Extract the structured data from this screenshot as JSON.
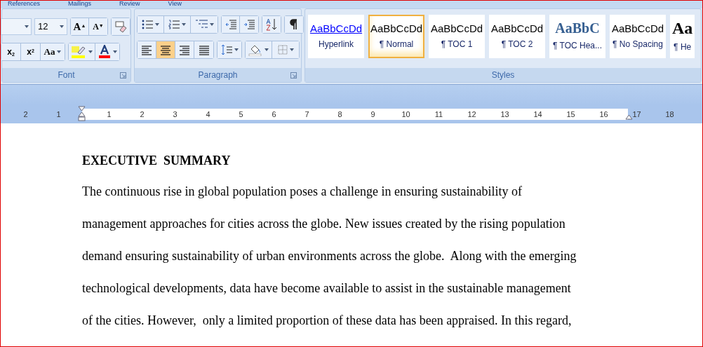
{
  "tabs": [
    "References",
    "Mailings",
    "Review",
    "View"
  ],
  "font_group": {
    "label": "Font",
    "size": "12",
    "grow": "A$^{▲}$",
    "shrink": "A$^{▼}$",
    "subscript": "x$_{2}$",
    "superscript": "x$^{2}$",
    "change_case": "Aa"
  },
  "paragraph_group": {
    "label": "Paragraph",
    "alignment": [
      {
        "kind": "left",
        "selected": false
      },
      {
        "kind": "center",
        "selected": true
      },
      {
        "kind": "right",
        "selected": false
      },
      {
        "kind": "justify",
        "selected": false
      }
    ]
  },
  "styles_group": {
    "label": "Styles",
    "styles": [
      {
        "sample": "AaBbCcDd",
        "name": "Hyperlink",
        "kind": "hyperlink",
        "selected": false
      },
      {
        "sample": "AaBbCcDd",
        "name": "¶ Normal",
        "kind": "plain",
        "selected": true
      },
      {
        "sample": "AaBbCcDd",
        "name": "¶ TOC 1",
        "kind": "plain",
        "selected": false
      },
      {
        "sample": "AaBbCcDd",
        "name": "¶ TOC 2",
        "kind": "plain",
        "selected": false
      },
      {
        "sample": "AaBbC",
        "name": "¶ TOC Hea...",
        "kind": "toc-heading",
        "selected": false
      },
      {
        "sample": "AaBbCcDd",
        "name": "¶ No Spacing",
        "kind": "plain",
        "selected": false
      },
      {
        "sample": "Aa",
        "name": "¶ He",
        "kind": "heading",
        "selected": false
      }
    ]
  },
  "ruler": [
    "2",
    "1",
    "1",
    "2",
    "3",
    "4",
    "5",
    "6",
    "7",
    "8",
    "9",
    "10",
    "11",
    "12",
    "13",
    "14",
    "15",
    "16",
    "17",
    "18"
  ],
  "document": {
    "heading": "EXECUTIVE  SUMMARY",
    "lines": [
      "The continuous rise in global population poses a challenge in ensuring sustainability of",
      "management approaches for cities across the globe. New issues created by the rising population",
      "demand ensuring sustainability of urban environments across the globe.  Along with the emerging",
      "technological developments, data have become available to assist in the sustainable management",
      "of the cities. However,  only a limited proportion of these data has been appraised. In this regard,"
    ]
  }
}
